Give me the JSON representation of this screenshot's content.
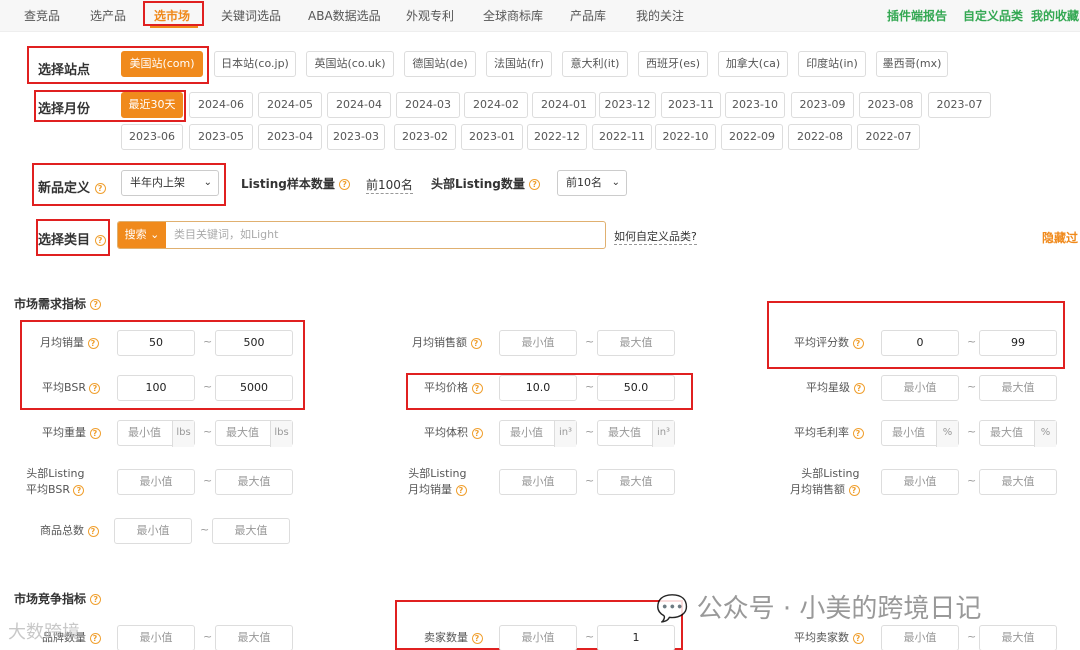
{
  "nav": {
    "tabs": [
      "查竞品",
      "选产品",
      "选市场",
      "关键词选品",
      "ABA数据选品",
      "外观专利",
      "全球商标库",
      "产品库",
      "我的关注"
    ],
    "right": [
      "插件端报告",
      "自定义品类",
      "我的收藏"
    ]
  },
  "site": {
    "label": "选择站点",
    "options": [
      "美国站(com)",
      "日本站(co.jp)",
      "英国站(co.uk)",
      "德国站(de)",
      "法国站(fr)",
      "意大利(it)",
      "西班牙(es)",
      "加拿大(ca)",
      "印度站(in)",
      "墨西哥(mx)"
    ]
  },
  "month": {
    "label": "选择月份",
    "row1": [
      "最近30天",
      "2024-06",
      "2024-05",
      "2024-04",
      "2024-03",
      "2024-02",
      "2024-01",
      "2023-12",
      "2023-11",
      "2023-10",
      "2023-09",
      "2023-08",
      "2023-07"
    ],
    "row2": [
      "2023-06",
      "2023-05",
      "2023-04",
      "2023-03",
      "2023-02",
      "2023-01",
      "2022-12",
      "2022-11",
      "2022-10",
      "2022-09",
      "2022-08",
      "2022-07"
    ]
  },
  "newdef": {
    "label": "新品定义",
    "select": "半年内上架",
    "sample_label": "Listing样本数量",
    "sample_value": "前100名",
    "head_label": "头部Listing数量",
    "head_select": "前10名"
  },
  "category": {
    "label": "选择类目",
    "search_btn": "搜索",
    "placeholder": "类目关键词，如Light",
    "help_link": "如何自定义品类?",
    "hide_link": "隐藏过"
  },
  "demand": {
    "title": "市场需求指标",
    "min_ph": "最小值",
    "max_ph": "最大值",
    "monthly_sales": {
      "label": "月均销量",
      "min": "50",
      "max": "500"
    },
    "avg_bsr": {
      "label": "平均BSR",
      "min": "100",
      "max": "5000"
    },
    "avg_weight": {
      "label": "平均重量",
      "unit": "lbs"
    },
    "head_bsr": {
      "label1": "头部Listing",
      "label2": "平均BSR"
    },
    "total_goods": {
      "label": "商品总数"
    },
    "monthly_revenue": {
      "label": "月均销售额"
    },
    "avg_price": {
      "label": "平均价格",
      "min": "10.0",
      "max": "50.0"
    },
    "avg_volume": {
      "label": "平均体积",
      "unit": "in³"
    },
    "head_sales": {
      "label1": "头部Listing",
      "label2": "月均销量"
    },
    "avg_reviews": {
      "label": "平均评分数",
      "min": "0",
      "max": "99"
    },
    "avg_rating": {
      "label": "平均星级"
    },
    "avg_margin": {
      "label": "平均毛利率",
      "unit": "%"
    },
    "head_revenue": {
      "label1": "头部Listing",
      "label2": "月均销售额"
    }
  },
  "competition": {
    "title": "市场竞争指标",
    "brand_count": {
      "label": "品牌数量"
    },
    "seller_count": {
      "label": "卖家数量",
      "max": "1"
    },
    "avg_sellers": {
      "label": "平均卖家数"
    }
  },
  "watermark": {
    "main": "公众号 · 小美的跨境日记",
    "corner": "大数跨境"
  }
}
